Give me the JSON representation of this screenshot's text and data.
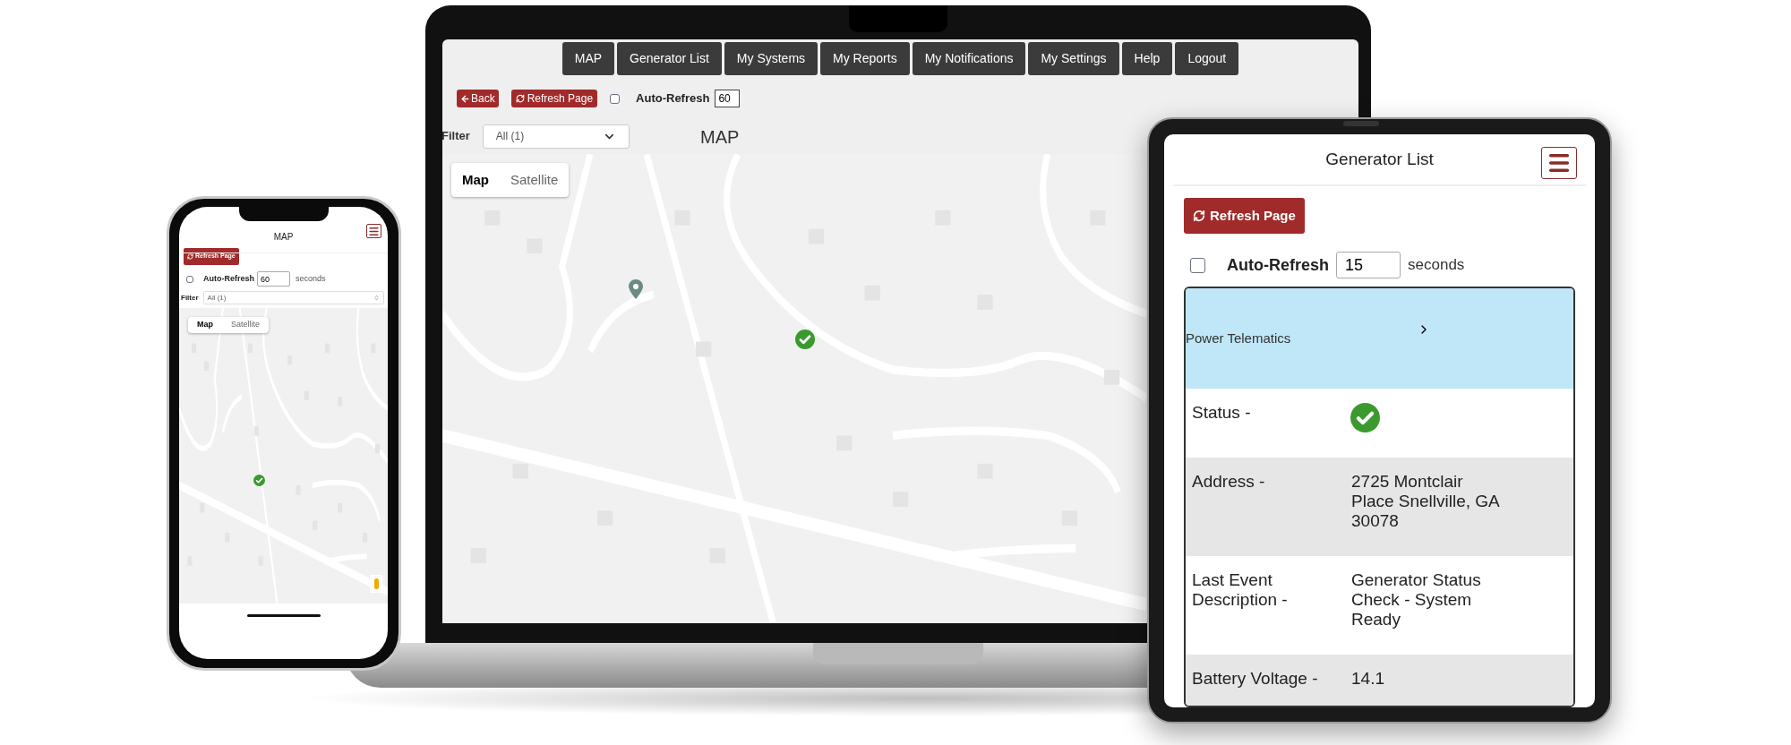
{
  "laptop": {
    "nav_items": [
      {
        "label": "MAP"
      },
      {
        "label": "Generator List"
      },
      {
        "label": "My Systems"
      },
      {
        "label": "My Reports"
      },
      {
        "label": "My Notifications"
      },
      {
        "label": "My Settings"
      },
      {
        "label": "Help"
      },
      {
        "label": "Logout"
      }
    ],
    "back_button": "Back",
    "refresh_button": "Refresh Page",
    "auto_refresh": {
      "label": "Auto-Refresh",
      "checked": false,
      "value": "60"
    },
    "filter": {
      "label": "Filter",
      "value": "All (1)"
    },
    "title": "MAP",
    "map_type_tabs": [
      {
        "label": "Map",
        "selected": true
      },
      {
        "label": "Satellite",
        "selected": false
      }
    ]
  },
  "phone": {
    "title": "MAP",
    "refresh_button": "Refresh Page",
    "auto_refresh": {
      "label": "Auto-Refresh",
      "checked": false,
      "value": "60",
      "unit": "seconds"
    },
    "filter": {
      "label": "Filter",
      "value": "All (1)"
    },
    "map_type_tabs": [
      {
        "label": "Map",
        "selected": true
      },
      {
        "label": "Satellite",
        "selected": false
      }
    ]
  },
  "tablet": {
    "title": "Generator List",
    "refresh_button": "Refresh Page",
    "auto_refresh": {
      "label": "Auto-Refresh",
      "checked": false,
      "value": "15",
      "unit": "seconds"
    },
    "list": {
      "header": "Power Telematics",
      "rows": [
        {
          "kind": "status",
          "label": "Status -"
        },
        {
          "kind": "text",
          "label": "Address -",
          "value": "2725 Montclair Place Snellville, GA 30078"
        },
        {
          "kind": "text",
          "label": "Last Event Description -",
          "value": "Generator Status Check - System Ready"
        },
        {
          "kind": "text",
          "label": "Battery Voltage -",
          "value": "14.1"
        }
      ]
    }
  }
}
